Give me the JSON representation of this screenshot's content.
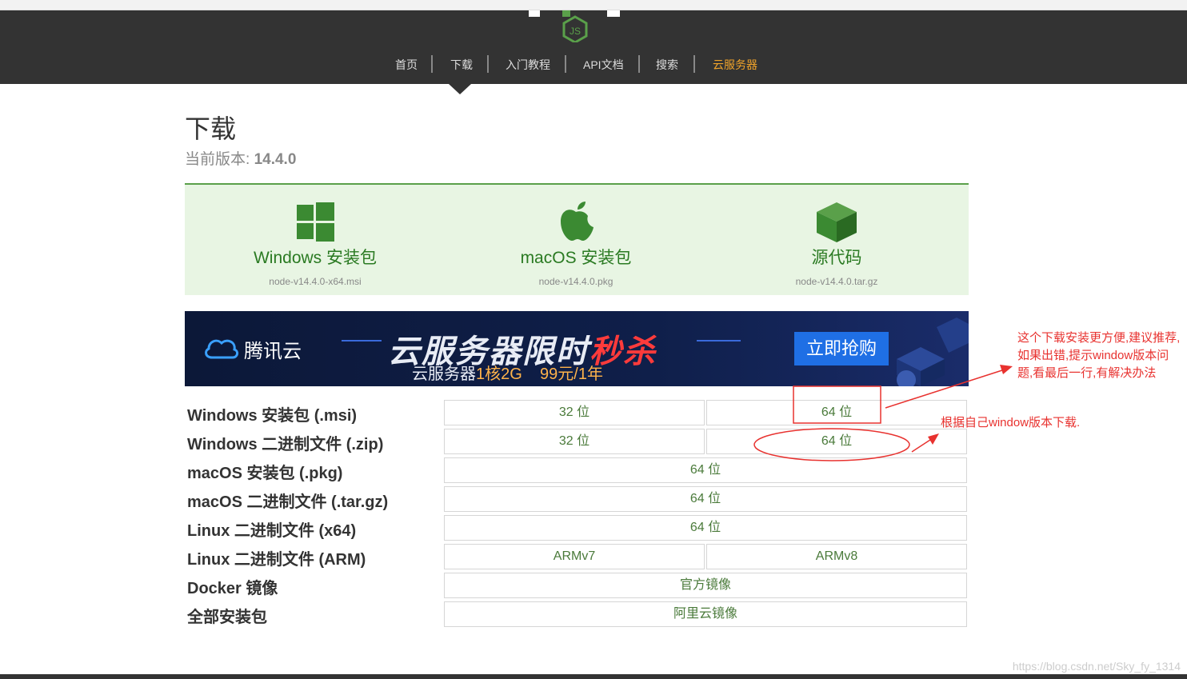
{
  "nav": {
    "items": [
      {
        "label": "首页"
      },
      {
        "label": "下载"
      },
      {
        "label": "入门教程"
      },
      {
        "label": "API文档"
      },
      {
        "label": "搜索"
      },
      {
        "label": "云服务器"
      }
    ]
  },
  "page": {
    "title": "下载",
    "version_label": "当前版本: ",
    "version_value": "14.4.0"
  },
  "downloads": [
    {
      "label": "Windows 安装包",
      "file": "node-v14.4.0-x64.msi",
      "icon": "windows-icon"
    },
    {
      "label": "macOS 安装包",
      "file": "node-v14.4.0.pkg",
      "icon": "apple-icon"
    },
    {
      "label": "源代码",
      "file": "node-v14.4.0.tar.gz",
      "icon": "cube-icon"
    }
  ],
  "banner": {
    "brand": "腾讯云",
    "headline_a": "云服务器限时",
    "headline_b": "秒杀",
    "sub_a": "云服务器",
    "sub_b": "1核2G",
    "sub_c": "99元/1年",
    "button": "立即抢购"
  },
  "table": [
    {
      "label": "Windows 安装包 (.msi)",
      "cells": [
        "32 位",
        "64 位"
      ]
    },
    {
      "label": "Windows 二进制文件 (.zip)",
      "cells": [
        "32 位",
        "64 位"
      ]
    },
    {
      "label": "macOS 安装包 (.pkg)",
      "cells": [
        "64 位"
      ]
    },
    {
      "label": "macOS 二进制文件 (.tar.gz)",
      "cells": [
        "64 位"
      ]
    },
    {
      "label": "Linux 二进制文件 (x64)",
      "cells": [
        "64 位"
      ]
    },
    {
      "label": "Linux 二进制文件 (ARM)",
      "cells": [
        "ARMv7",
        "ARMv8"
      ]
    },
    {
      "label": "Docker 镜像",
      "cells": [
        "官方镜像"
      ]
    },
    {
      "label": "全部安装包",
      "cells": [
        "阿里云镜像"
      ]
    }
  ],
  "annotations": {
    "note1": "这个下载安装更方便,建议推荐,如果出错,提示window版本问题,看最后一行,有解决办法",
    "note2": "根据自己window版本下载."
  },
  "watermark": "https://blog.csdn.net/Sky_fy_1314",
  "colors": {
    "accent": "#f0a32a",
    "annotation": "#e8322f",
    "green": "#2a7a22"
  }
}
